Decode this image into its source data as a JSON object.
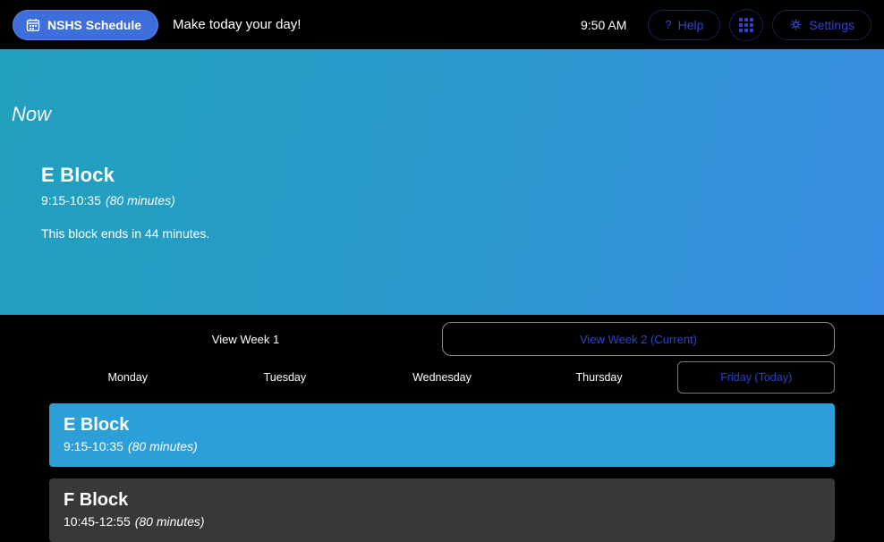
{
  "header": {
    "app_button_label": "NSHS Schedule",
    "tagline": "Make today your day!",
    "time": "9:50 AM",
    "help_label": "Help",
    "help_glyph": "?",
    "settings_label": "Settings"
  },
  "now": {
    "section_label": "Now",
    "block_name": "E Block",
    "time_range": "9:15-10:35",
    "duration": "(80 minutes)",
    "status": "This block ends in 44 minutes."
  },
  "week_tabs": [
    {
      "label": "View Week 1",
      "active": false
    },
    {
      "label": "View Week 2 (Current)",
      "active": true
    }
  ],
  "day_tabs": [
    {
      "label": "Monday",
      "active": false
    },
    {
      "label": "Tuesday",
      "active": false
    },
    {
      "label": "Wednesday",
      "active": false
    },
    {
      "label": "Thursday",
      "active": false
    },
    {
      "label": "Friday (Today)",
      "active": true
    }
  ],
  "schedule": [
    {
      "name": "E Block",
      "time_range": "9:15-10:35",
      "duration": "(80 minutes)",
      "current": true
    },
    {
      "name": "F Block",
      "time_range": "10:45-12:55",
      "duration": "(80 minutes)",
      "current": false
    }
  ],
  "colors": {
    "header_bg": "#000000",
    "app_button_blue": "#3d6edb",
    "link_blue": "#2c44cd",
    "gradient_start": "#21a0bd",
    "gradient_end": "#3b8de2",
    "current_card_blue": "#2d9fd8",
    "card_gray": "#383838"
  }
}
